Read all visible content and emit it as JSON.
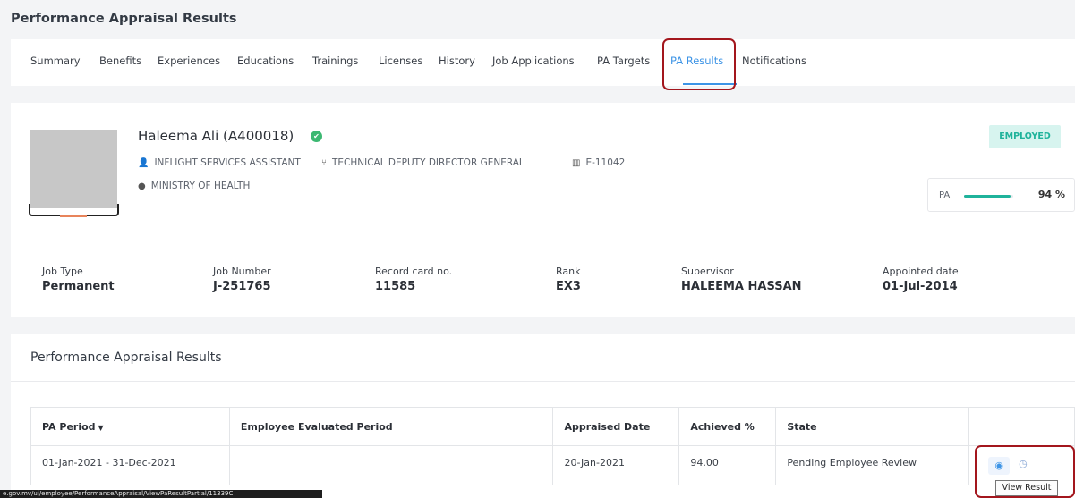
{
  "page": {
    "title": "Performance Appraisal Results"
  },
  "tabs": [
    {
      "label": "Summary"
    },
    {
      "label": "Benefits"
    },
    {
      "label": "Experiences"
    },
    {
      "label": "Educations"
    },
    {
      "label": "Trainings"
    },
    {
      "label": "Licenses"
    },
    {
      "label": "History"
    },
    {
      "label": "Job Applications"
    },
    {
      "label": "PA Targets"
    },
    {
      "label": "PA Results",
      "active": true
    },
    {
      "label": "Notifications"
    }
  ],
  "employee": {
    "name": "Haleema Ali  (A400018)",
    "position": "INFLIGHT SERVICES ASSISTANT",
    "department": "TECHNICAL DEPUTY DIRECTOR GENERAL",
    "employee_code": "E-11042",
    "ministry": "MINISTRY OF HEALTH",
    "status_badge": "EMPLOYED",
    "pa_label": "PA",
    "pa_percent": 94,
    "pa_value": "94 %"
  },
  "info": [
    {
      "label": "Job Type",
      "value": "Permanent"
    },
    {
      "label": "Job Number",
      "value": "J-251765"
    },
    {
      "label": "Record card no.",
      "value": "11585"
    },
    {
      "label": "Rank",
      "value": "EX3"
    },
    {
      "label": "Supervisor",
      "value": "HALEEMA HASSAN"
    },
    {
      "label": "Appointed date",
      "value": "01-Jul-2014"
    }
  ],
  "results": {
    "title": "Performance Appraisal Results",
    "columns": [
      "PA Period",
      "Employee Evaluated Period",
      "Appraised Date",
      "Achieved %",
      "State",
      ""
    ],
    "rows": [
      [
        "01-Jan-2021 - 31-Dec-2021",
        "",
        "20-Jan-2021",
        "94.00",
        "Pending Employee Review"
      ]
    ]
  },
  "tooltip": {
    "text": "View Result"
  },
  "status_bar": {
    "url": "e.gov.mv/ui/employee/PerformanceAppraisal/ViewPaResultPartial/11339C"
  },
  "colors": {
    "accent": "#3d94e6",
    "success": "#1fb39b",
    "highlight": "#a3161d"
  }
}
